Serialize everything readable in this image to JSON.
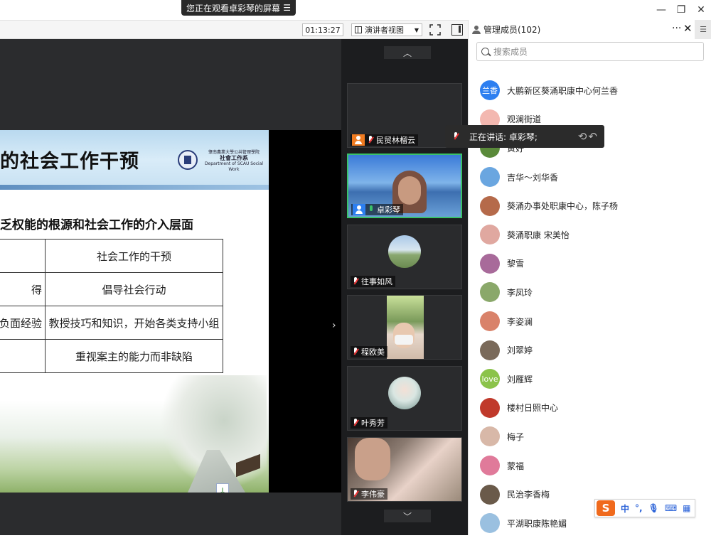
{
  "top": {
    "share_banner": "您正在观看卓彩琴的屏幕",
    "share_menu": "☰"
  },
  "window": {
    "minimize": "—",
    "restore": "❐",
    "close": "✕"
  },
  "toolbar": {
    "timer": "01:13:27",
    "view_label": "演讲者视图"
  },
  "slide": {
    "title": "的社会工作干预",
    "school_line1": "肇南農業大學公共管理學院",
    "school_line2": "社會工作系",
    "school_line3": "Department of SCAU Social Work",
    "subtitle": "乏权能的根源和社会工作的介入层面",
    "rows": [
      {
        "left": "",
        "right": "社会工作的干预"
      },
      {
        "left": "得",
        "right": "倡导社会行动"
      },
      {
        "left": "负面经验",
        "right": "教授技巧和知识，开始各类支持小组"
      },
      {
        "left": "",
        "right": "重视案主的能力而非缺陷"
      }
    ]
  },
  "gallery": {
    "tiles": [
      {
        "name": "民贸林榴云",
        "host": "orange",
        "mic": "muted"
      },
      {
        "name": "卓彩琴",
        "host": "blue",
        "mic": "on"
      },
      {
        "name": "往事如风",
        "mic": "muted"
      },
      {
        "name": "程欧美",
        "mic": "muted"
      },
      {
        "name": "叶秀芳",
        "mic": "muted"
      },
      {
        "name": "李伟豪",
        "mic": "muted"
      }
    ]
  },
  "panel": {
    "title": "管理成员(102)",
    "more": "···",
    "close": "✕",
    "menu": "☰",
    "search_placeholder": "搜索成员",
    "members": [
      {
        "name": "大鹏新区葵涌职康中心何兰香",
        "avatar_text": "兰香",
        "color": "#2d7ff0"
      },
      {
        "name": "观澜街道",
        "avatar_text": "",
        "color": "#f3b8b0"
      },
      {
        "name": "黄好",
        "avatar_text": "",
        "color": "#5a8a3a"
      },
      {
        "name": "吉华～刘华香",
        "avatar_text": "",
        "color": "#6aa6e0"
      },
      {
        "name": "葵涌办事处职康中心，陈子杨",
        "avatar_text": "",
        "color": "#b56a4a"
      },
      {
        "name": "葵涌职康 宋美怡",
        "avatar_text": "",
        "color": "#e0a8a0"
      },
      {
        "name": "黎雪",
        "avatar_text": "",
        "color": "#a86a9a"
      },
      {
        "name": "李凤玲",
        "avatar_text": "",
        "color": "#8aa86a"
      },
      {
        "name": "李姿澜",
        "avatar_text": "",
        "color": "#d9826a"
      },
      {
        "name": "刘翠婷",
        "avatar_text": "",
        "color": "#7a6a5a"
      },
      {
        "name": "刘雁辉",
        "avatar_text": "love",
        "color": "#8bc34a"
      },
      {
        "name": "楼村日照中心",
        "avatar_text": "",
        "color": "#c0392b"
      },
      {
        "name": "梅子",
        "avatar_text": "",
        "color": "#d8b8a8"
      },
      {
        "name": "蒙福",
        "avatar_text": "",
        "color": "#e07a9a"
      },
      {
        "name": "民治李香梅",
        "avatar_text": "",
        "color": "#6a5a4a"
      },
      {
        "name": "平湖职康陈艳媚",
        "avatar_text": "",
        "color": "#9ac0e0"
      }
    ]
  },
  "speaking": {
    "text": "正在讲话: 卓彩琴;"
  },
  "ime": {
    "logo": "S",
    "lang": "中",
    "punct": "°,",
    "mic": "🎙",
    "kbd": "⌨",
    "grid": "▦"
  }
}
